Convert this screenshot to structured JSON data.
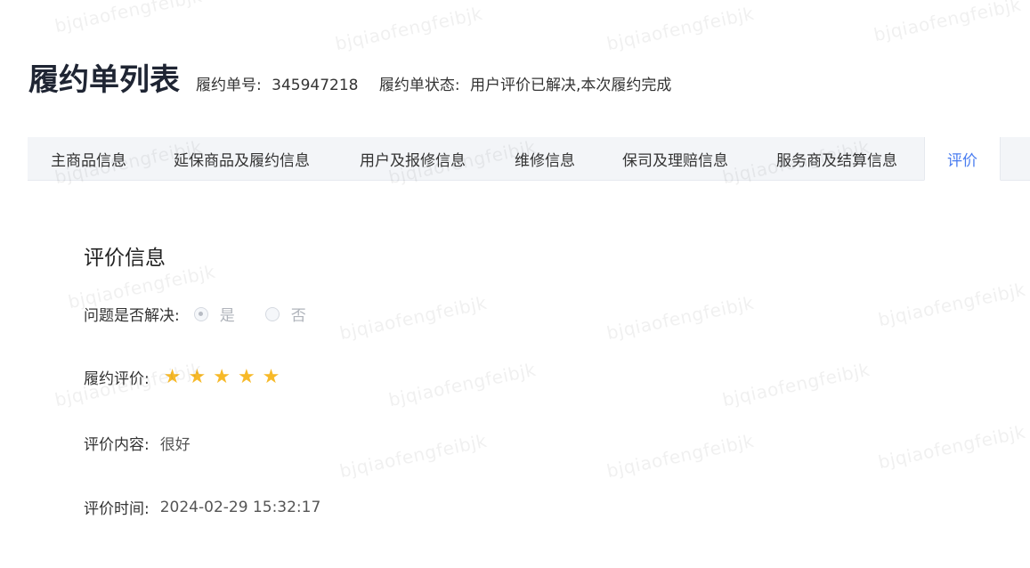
{
  "header": {
    "title": "履约单列表",
    "order_no_label": "履约单号:",
    "order_no_value": "345947218",
    "status_label": "履约单状态:",
    "status_value": "用户评价已解决,本次履约完成"
  },
  "tabs": [
    {
      "label": "主商品信息",
      "active": false
    },
    {
      "label": "延保商品及履约信息",
      "active": false
    },
    {
      "label": "用户及报修信息",
      "active": false
    },
    {
      "label": "维修信息",
      "active": false
    },
    {
      "label": "保司及理赔信息",
      "active": false
    },
    {
      "label": "服务商及结算信息",
      "active": false
    },
    {
      "label": "评价",
      "active": true
    }
  ],
  "evaluation": {
    "section_title": "评价信息",
    "resolved_label": "问题是否解决:",
    "resolved_options": [
      {
        "label": "是",
        "checked": true
      },
      {
        "label": "否",
        "checked": false
      }
    ],
    "rating_label": "履约评价:",
    "rating_stars": 5,
    "rating_max": 5,
    "content_label": "评价内容:",
    "content_value": "很好",
    "time_label": "评价时间:",
    "time_value": "2024-02-29 15:32:17"
  },
  "watermark_text": "bjqiaofengfeibjk",
  "colors": {
    "accent": "#4a7df0",
    "star": "#f7b928",
    "tab_bar_bg": "#f3f5f8"
  }
}
